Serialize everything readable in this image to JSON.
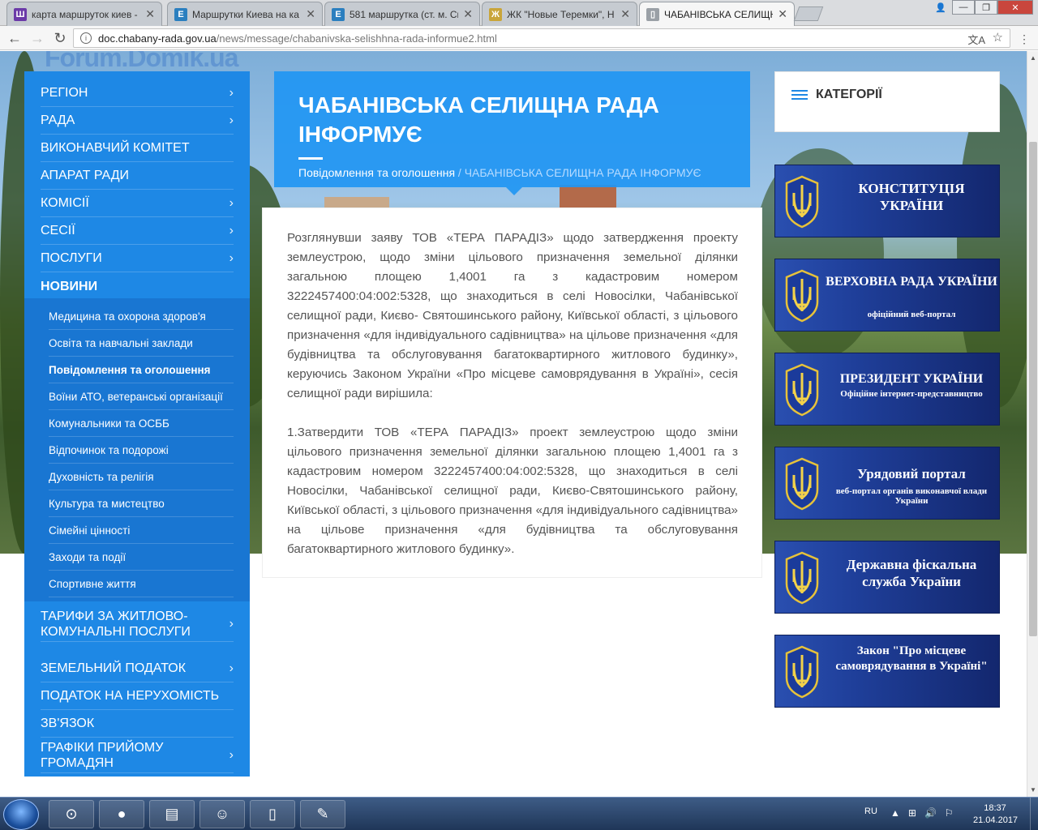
{
  "browser": {
    "tabs": [
      {
        "label": "карта маршруток киев -",
        "fav_color": "#6b3aa8",
        "fav_char": "Ш"
      },
      {
        "label": "Маршрутки Киева на ка",
        "fav_color": "#2b7fbf",
        "fav_char": "E"
      },
      {
        "label": "581 маршрутка (ст. м. Св",
        "fav_color": "#2b7fbf",
        "fav_char": "E"
      },
      {
        "label": "ЖК \"Новые Теремки\", Н",
        "fav_color": "#c9a53a",
        "fav_char": "Ж"
      },
      {
        "label": "ЧАБАНІВСЬКА СЕЛИЩН",
        "fav_color": "#9aa0a6",
        "fav_char": "▯"
      }
    ],
    "close_glyph": "✕",
    "url_host": "doc.chabany-rada.gov.ua",
    "url_path": "/news/message/chabanivska-selishhna-rada-informue2.html",
    "info_glyph": "i",
    "translate_glyph": "文A",
    "star_glyph": "☆",
    "menu_glyph": "⋮",
    "back_glyph": "←",
    "forward_glyph": "→",
    "reload_glyph": "↻",
    "win_minimize": "—",
    "win_maximize": "❐",
    "win_close": "✕",
    "user_glyph": "👤"
  },
  "watermark": {
    "text": "Forum.Domik.ua",
    "dot_colors": [
      "#3a6fd8",
      "#d8c23a",
      "#3ab15a",
      "#c23a8a"
    ]
  },
  "sidebar": {
    "items": [
      {
        "label": "РЕГІОН",
        "chevron": "›"
      },
      {
        "label": "РАДА",
        "chevron": "›"
      },
      {
        "label": "ВИКОНАВЧИЙ КОМІТЕТ",
        "chevron": ""
      },
      {
        "label": "АПАРАТ РАДИ",
        "chevron": ""
      },
      {
        "label": "КОМІСІЇ",
        "chevron": "›"
      },
      {
        "label": "СЕСІЇ",
        "chevron": "›"
      },
      {
        "label": "ПОСЛУГИ",
        "chevron": "›"
      },
      {
        "label": "НОВИНИ",
        "chevron": ""
      }
    ],
    "subitems": [
      "Медицина та охорона здоров'я",
      "Освіта та навчальні заклади",
      "Повідомлення та оголошення",
      "Воїни АТО, ветеранські організації",
      "Комунальники та ОСББ",
      "Відпочинок та подорожі",
      "Духовність та релігія",
      "Культура та мистецтво",
      "Сімейні цінності",
      "Заходи та події",
      "Спортивне життя"
    ],
    "current_subitem": "Повідомлення та оголошення",
    "bottom_items": [
      {
        "label": "ТАРИФИ ЗА ЖИТЛОВО-КОМУНАЛЬНІ ПОСЛУГИ",
        "chevron": "›"
      },
      {
        "label": "ЗЕМЕЛЬНИЙ ПОДАТОК",
        "chevron": "›"
      },
      {
        "label": "ПОДАТОК НА НЕРУХОМІСТЬ",
        "chevron": ""
      },
      {
        "label": "ЗВ'ЯЗОК",
        "chevron": ""
      },
      {
        "label": "ГРАФІКИ ПРИЙОМУ ГРОМАДЯН",
        "chevron": "›"
      }
    ]
  },
  "header": {
    "title": "ЧАБАНІВСЬКА СЕЛИЩНА РАДА ІНФОРМУЄ",
    "breadcrumb_link": "Повідомлення та оголошення",
    "breadcrumb_sep": " / ",
    "breadcrumb_current": "ЧАБАНІВСЬКА СЕЛИЩНА РАДА ІНФОРМУЄ"
  },
  "article": {
    "p1": "Розглянувши заяву ТОВ «ТЕРА ПАРАДІЗ» щодо затвердження проекту землеустрою, щодо зміни цільового призначення земельної ділянки загальною площею 1,4001 га з кадастровим номером 3222457400:04:002:5328, що знаходиться в селі Новосілки, Чабанівської селищної ради, Києво- Святошинського району, Київської області, з цільового призначення «для індивідуального садівництва» на цільове призначення «для будівництва та обслуговування багатоквартирного житлового будинку», керуючись Законом України «Про місцеве самоврядування в Україні», сесія селищної ради вирішила:",
    "p2": "1.Затвердити ТОВ «ТЕРА ПАРАДІЗ» проект землеустрою щодо зміни цільового призначення земельної ділянки загальною площею 1,4001 га з кадастровим номером 3222457400:04:002:5328, що знаходиться в селі Новосілки, Чабанівської селищної ради, Києво-Святошинського району, Київської області, з цільового призначення «для індивідуального садівництва» на цільове призначення «для будівництва та обслуговування багатоквартирного житлового будинку»."
  },
  "categories": {
    "title": "КАТЕГОРІЇ"
  },
  "banners": [
    {
      "title": "КОНСТИТУЦІЯ УКРАЇНИ",
      "subtitle": ""
    },
    {
      "title": "ВЕРХОВНА РАДА УКРАЇНИ",
      "subtitle": "офіційний веб-портал"
    },
    {
      "title": "ПРЕЗИДЕНТ УКРАЇНИ",
      "subtitle": "Офіційне інтернет-представництво"
    },
    {
      "title": "Урядовий портал",
      "subtitle": "веб-портал органів виконавчої влади України"
    },
    {
      "title": "Державна фіскальна служба України",
      "subtitle": ""
    },
    {
      "title": "Закон \"Про місцеве самоврядування в Україні\"",
      "subtitle": ""
    }
  ],
  "taskbar": {
    "lang": "RU",
    "time": "18:37",
    "date": "21.04.2017",
    "tray_icons": [
      "▲",
      "⊞",
      "🔊",
      "⚐"
    ],
    "apps": [
      {
        "name": "app-ie",
        "glyph": "⊙"
      },
      {
        "name": "app-chrome",
        "glyph": "●"
      },
      {
        "name": "app-explorer",
        "glyph": "▤"
      },
      {
        "name": "app-users",
        "glyph": "☺"
      },
      {
        "name": "app-doc",
        "glyph": "▯"
      },
      {
        "name": "app-paint",
        "glyph": "✎"
      }
    ]
  }
}
